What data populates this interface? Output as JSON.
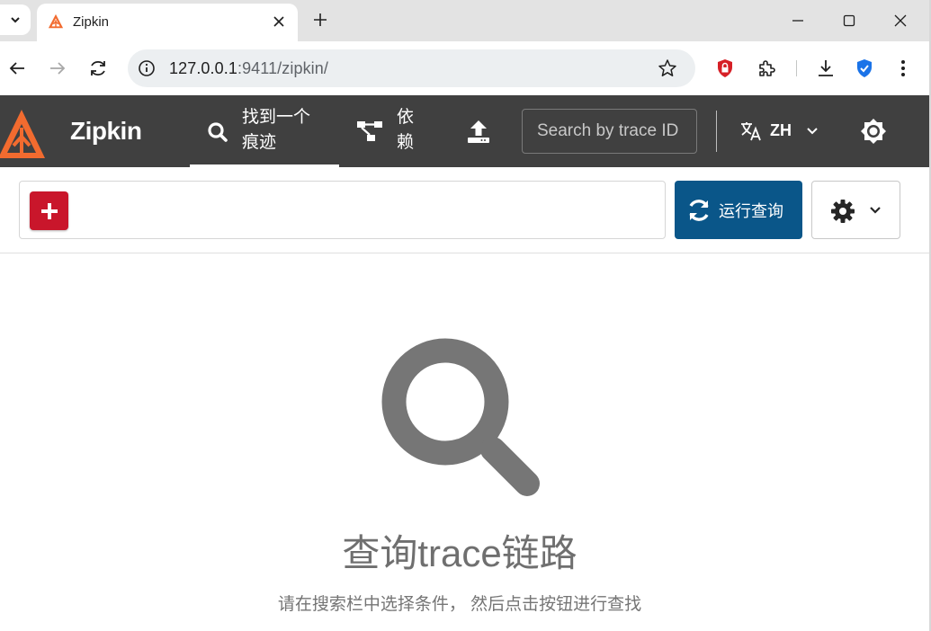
{
  "browser": {
    "tab": {
      "title": "Zipkin",
      "favicon": "zipkin-logo-icon"
    },
    "url": {
      "host": "127.0.0.1",
      "rest": ":9411/zipkin/"
    },
    "icons": [
      "back-icon",
      "forward-icon",
      "reload-icon",
      "site-info-icon",
      "bookmark-star-icon",
      "extension-shield-icon",
      "extensions-puzzle-icon",
      "download-icon",
      "security-shield-icon",
      "more-vert-icon"
    ]
  },
  "app": {
    "brand": "Zipkin",
    "nav": [
      {
        "label": "找到一个痕迹",
        "icon": "search-icon",
        "active": true
      },
      {
        "label": "依赖",
        "icon": "dependencies-icon",
        "active": false
      },
      {
        "label": "",
        "icon": "upload-icon",
        "active": false
      }
    ],
    "search_placeholder": "Search by trace ID",
    "language": "ZH",
    "colors": {
      "header": "#404040",
      "accent_logo": "#f26b2f",
      "add_button": "#c9162b",
      "run_button": "#0a5689"
    }
  },
  "query": {
    "run_label": "运行查询"
  },
  "empty_state": {
    "title": "查询trace链路",
    "description": "请在搜索栏中选择条件， 然后点击按钮进行查找"
  }
}
